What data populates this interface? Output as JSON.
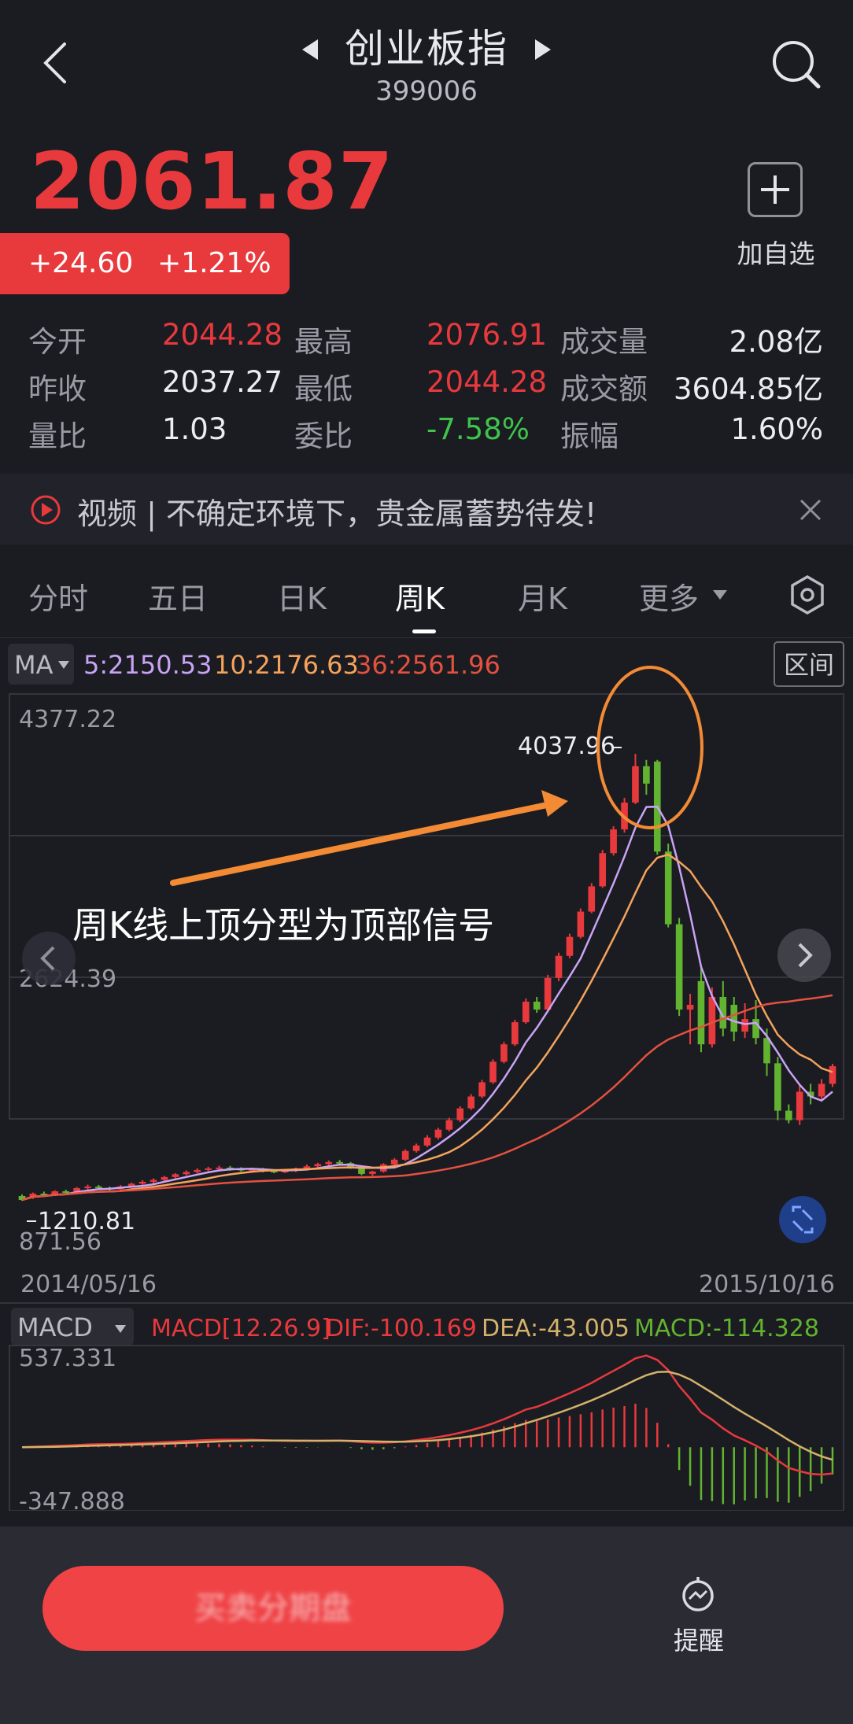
{
  "header": {
    "title": "创业板指",
    "code": "399006",
    "back_icon": "chevron-left-icon",
    "prev_icon": "triangle-left-icon",
    "next_icon": "triangle-right-icon",
    "search_icon": "search-icon"
  },
  "quote": {
    "price": "2061.87",
    "change": "+24.60",
    "change_pct": "+1.21%",
    "add_label": "加自选"
  },
  "stats": [
    {
      "label": "今开",
      "value": "2044.28",
      "color": "red"
    },
    {
      "label": "最高",
      "value": "2076.91",
      "color": "red"
    },
    {
      "label": "成交量",
      "value": "2.08亿",
      "color": "white"
    },
    {
      "label": "昨收",
      "value": "2037.27",
      "color": "white"
    },
    {
      "label": "最低",
      "value": "2044.28",
      "color": "red"
    },
    {
      "label": "成交额",
      "value": "3604.85亿",
      "color": "white"
    },
    {
      "label": "量比",
      "value": "1.03",
      "color": "white"
    },
    {
      "label": "委比",
      "value": "-7.58%",
      "color": "green"
    },
    {
      "label": "振幅",
      "value": "1.60%",
      "color": "white"
    }
  ],
  "notice": {
    "text": "视频 | 不确定环境下，贵金属蓄势待发!"
  },
  "tabs": [
    {
      "label": "分时"
    },
    {
      "label": "五日"
    },
    {
      "label": "日K"
    },
    {
      "label": "周K",
      "active": true
    },
    {
      "label": "月K"
    },
    {
      "label": "更多"
    }
  ],
  "ma_bar": {
    "ma_label": "MA",
    "ma5": "5:2150.53",
    "ma10": "10:2176.63",
    "ma36": "36:2561.96",
    "range_label": "区间"
  },
  "chart_data": {
    "type": "candlestick",
    "y_labels": [
      "4377.22",
      "2624.39",
      "871.56"
    ],
    "ylim": [
      871.56,
      4377.22
    ],
    "x_start": "2014/05/16",
    "x_end": "2015/10/16",
    "max_label": "4037.96",
    "min_label": "1210.81",
    "annotation": "周K线上顶分型为顶部信号",
    "candles": [
      [
        1240,
        1215,
        1250,
        1210.81
      ],
      [
        1230,
        1255,
        1262,
        1222
      ],
      [
        1255,
        1250,
        1268,
        1242
      ],
      [
        1250,
        1270,
        1276,
        1244
      ],
      [
        1270,
        1265,
        1280,
        1255
      ],
      [
        1268,
        1290,
        1296,
        1262
      ],
      [
        1290,
        1300,
        1312,
        1282
      ],
      [
        1300,
        1292,
        1310,
        1280
      ],
      [
        1292,
        1282,
        1300,
        1270
      ],
      [
        1282,
        1300,
        1310,
        1275
      ],
      [
        1300,
        1318,
        1325,
        1294
      ],
      [
        1318,
        1330,
        1340,
        1310
      ],
      [
        1330,
        1342,
        1352,
        1320
      ],
      [
        1342,
        1360,
        1368,
        1334
      ],
      [
        1360,
        1378,
        1385,
        1352
      ],
      [
        1378,
        1392,
        1402,
        1370
      ],
      [
        1392,
        1405,
        1415,
        1384
      ],
      [
        1405,
        1415,
        1425,
        1398
      ],
      [
        1415,
        1420,
        1432,
        1405
      ],
      [
        1420,
        1412,
        1430,
        1400
      ],
      [
        1412,
        1405,
        1422,
        1395
      ],
      [
        1405,
        1410,
        1420,
        1396
      ],
      [
        1410,
        1400,
        1418,
        1390
      ],
      [
        1400,
        1395,
        1410,
        1385
      ],
      [
        1395,
        1400,
        1408,
        1386
      ],
      [
        1400,
        1415,
        1420,
        1392
      ],
      [
        1415,
        1428,
        1440,
        1408
      ],
      [
        1428,
        1442,
        1450,
        1420
      ],
      [
        1442,
        1455,
        1465,
        1432
      ],
      [
        1455,
        1448,
        1468,
        1440
      ],
      [
        1448,
        1420,
        1455,
        1412
      ],
      [
        1420,
        1380,
        1428,
        1372
      ],
      [
        1380,
        1395,
        1400,
        1368
      ],
      [
        1395,
        1440,
        1448,
        1388
      ],
      [
        1440,
        1470,
        1480,
        1432
      ],
      [
        1470,
        1525,
        1535,
        1462
      ],
      [
        1525,
        1560,
        1572,
        1515
      ],
      [
        1560,
        1610,
        1625,
        1550
      ],
      [
        1610,
        1660,
        1672,
        1598
      ],
      [
        1660,
        1720,
        1735,
        1650
      ],
      [
        1720,
        1795,
        1808,
        1708
      ],
      [
        1795,
        1870,
        1885,
        1785
      ],
      [
        1870,
        1960,
        1975,
        1860
      ],
      [
        1960,
        2090,
        2105,
        1950
      ],
      [
        2090,
        2200,
        2215,
        2080
      ],
      [
        2200,
        2340,
        2355,
        2190
      ],
      [
        2340,
        2470,
        2490,
        2330
      ],
      [
        2470,
        2420,
        2500,
        2400
      ],
      [
        2420,
        2620,
        2640,
        2410
      ],
      [
        2620,
        2760,
        2780,
        2600
      ],
      [
        2760,
        2880,
        2900,
        2745
      ],
      [
        2880,
        3040,
        3060,
        2870
      ],
      [
        3040,
        3200,
        3220,
        3030
      ],
      [
        3200,
        3410,
        3430,
        3190
      ],
      [
        3410,
        3560,
        3580,
        3395
      ],
      [
        3560,
        3730,
        3760,
        3540
      ],
      [
        3730,
        3960,
        4037.96,
        3720
      ],
      [
        3960,
        3850,
        4000,
        3780
      ],
      [
        3990,
        3420,
        4000,
        3400
      ],
      [
        3420,
        2960,
        3470,
        2940
      ],
      [
        2960,
        2420,
        3000,
        2380
      ],
      [
        2420,
        2450,
        2520,
        2200
      ],
      [
        2600,
        2200,
        2700,
        2150
      ],
      [
        2200,
        2500,
        2560,
        2180
      ],
      [
        2500,
        2300,
        2600,
        2250
      ],
      [
        2450,
        2280,
        2500,
        2220
      ],
      [
        2280,
        2360,
        2460,
        2240
      ],
      [
        2360,
        2240,
        2480,
        2200
      ],
      [
        2240,
        2080,
        2300,
        2000
      ],
      [
        2080,
        1780,
        2120,
        1720
      ],
      [
        1780,
        1720,
        1820,
        1700
      ],
      [
        1720,
        1900,
        1940,
        1690
      ],
      [
        1900,
        1870,
        1950,
        1820
      ],
      [
        1870,
        1950,
        1980,
        1840
      ],
      [
        1950,
        2061.87,
        2076.91,
        1930
      ]
    ],
    "macd": {
      "label": "MACD",
      "params": "MACD[12.26.9]",
      "dif": "DIF:-100.169",
      "dea": "DEA:-43.005",
      "macd": "MACD:-114.328",
      "y_labels": [
        "537.331",
        "-347.888"
      ],
      "ylim": [
        -347.888,
        537.331
      ]
    }
  },
  "footer": {
    "trade_label": "买卖分期盘",
    "remind_label": "提醒",
    "remind_icon": "alarm-clock-icon"
  },
  "colors": {
    "up": "#e8393d",
    "down": "#62b32f",
    "ma5": "#c9a3f5",
    "ma10": "#f5a35c",
    "ma36": "#e4513f",
    "accent": "#f38b35"
  }
}
